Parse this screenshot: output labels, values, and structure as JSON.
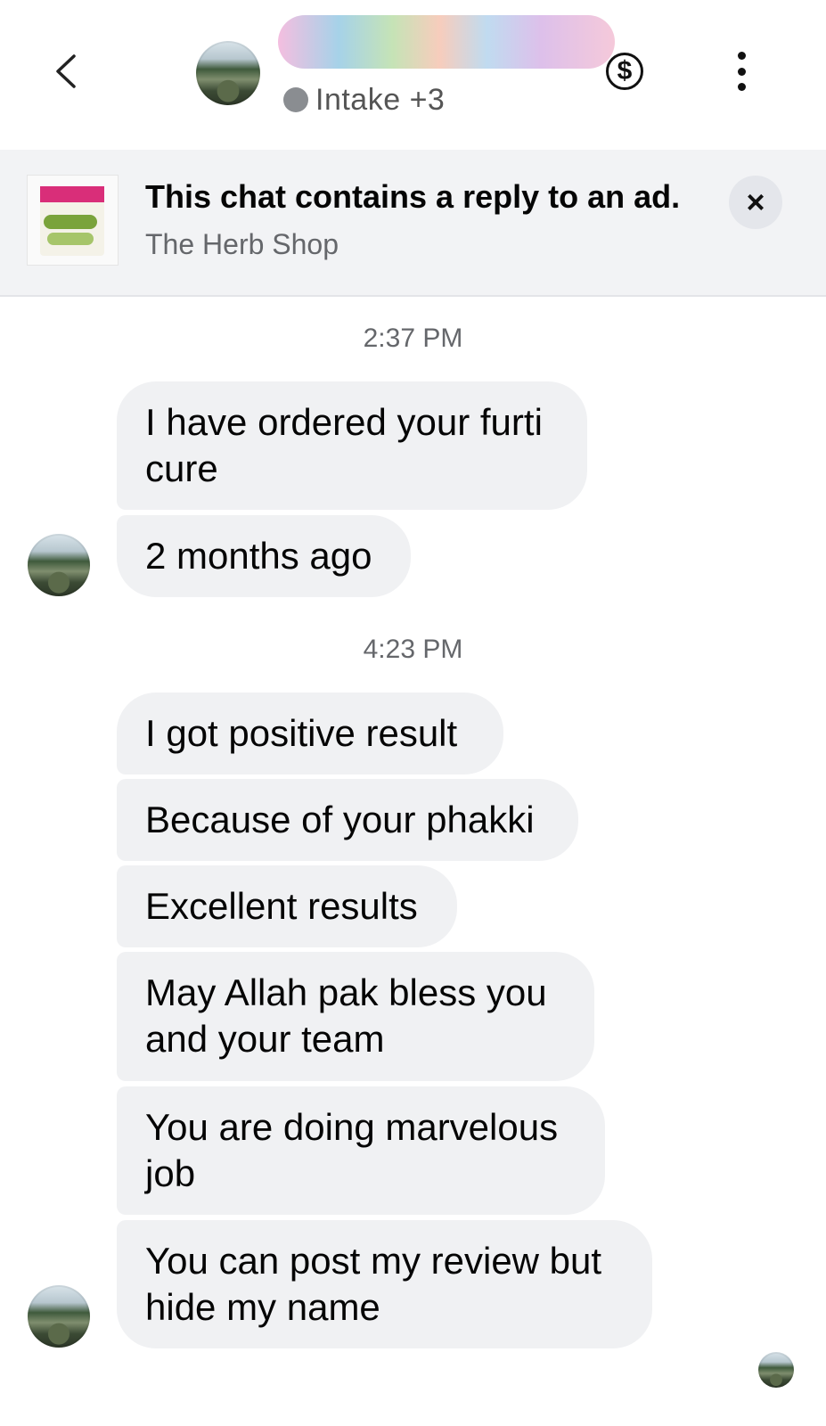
{
  "header": {
    "status_text": "Intake +3",
    "icons": [
      "back-arrow-icon",
      "dollar-icon",
      "more-options-icon"
    ]
  },
  "ad_banner": {
    "title": "This chat contains a reply to an ad.",
    "subtitle": "The Herb Shop",
    "close_symbol": "×"
  },
  "conversation": {
    "groups": [
      {
        "timestamp": "2:37 PM",
        "messages": [
          "I have ordered your furti\ncure",
          "2 months ago"
        ]
      },
      {
        "timestamp": "4:23 PM",
        "messages": [
          "I got positive result",
          "Because of your phakki",
          "Excellent results",
          "May Allah pak bless you\nand your team",
          "You are doing marvelous\njob",
          "You can post my review but\nhide my name"
        ]
      }
    ]
  },
  "colors": {
    "bubble_bg": "#f0f1f3",
    "banner_bg": "#f2f3f5",
    "secondary_text": "#65676b"
  }
}
